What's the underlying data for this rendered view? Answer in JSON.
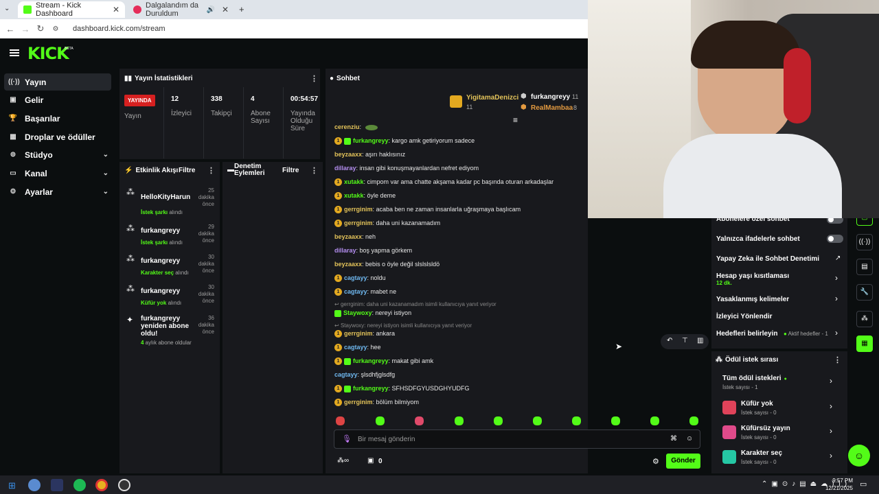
{
  "browser": {
    "tabs": [
      {
        "title": "Stream - Kick Dashboard"
      },
      {
        "title": "Dalgalandım da Duruldum"
      }
    ],
    "url": "dashboard.kick.com/stream"
  },
  "brand": {
    "logo": "KICK",
    "beta": "BETA",
    "accent": "#53fc18"
  },
  "sidebar": {
    "items": [
      {
        "label": "Yayın",
        "icon": "broadcast-icon"
      },
      {
        "label": "Gelir",
        "icon": "money-icon"
      },
      {
        "label": "Başarılar",
        "icon": "trophy-icon"
      },
      {
        "label": "Droplar ve ödüller",
        "icon": "gift-icon"
      },
      {
        "label": "Stüdyo",
        "icon": "studio-icon"
      },
      {
        "label": "Kanal",
        "icon": "channel-icon"
      },
      {
        "label": "Ayarlar",
        "icon": "gear-icon"
      }
    ]
  },
  "stats": {
    "title": "Yayın İstatistikleri",
    "live_badge": "YAYINDA",
    "cells": [
      {
        "value": "",
        "label": "Yayın"
      },
      {
        "value": "12",
        "label": "İzleyici"
      },
      {
        "value": "338",
        "label": "Takipçi"
      },
      {
        "value": "4",
        "label": "Abone Sayısı"
      },
      {
        "value": "00:54:57",
        "label": "Yayında Olduğu Süre"
      }
    ]
  },
  "activity": {
    "title": "Etkinlik Akışı",
    "filter": "Filtre",
    "items": [
      {
        "user": "HelloKityHarun",
        "time": "25 dakika önce",
        "highlight": "İstek şarkı",
        "rest": " alındı"
      },
      {
        "user": "furkangreyy",
        "time": "29 dakika önce",
        "highlight": "İstek şarkı",
        "rest": " alındı"
      },
      {
        "user": "furkangreyy",
        "time": "30 dakika önce",
        "highlight": "Karakter seç",
        "rest": " alındı"
      },
      {
        "user": "furkangreyy",
        "time": "30 dakika önce",
        "highlight": "Küfür yok",
        "rest": " alındı"
      },
      {
        "user": "furkangreyy yeniden abone oldu!",
        "time": "36 dakika önce",
        "highlight": "4",
        "rest": " aylık abone oldular"
      }
    ]
  },
  "moderation": {
    "title": "Denetim Eylemleri",
    "filter": "Filtre"
  },
  "chat": {
    "title": "Sohbet",
    "top_users": [
      {
        "name": "YigitamaDenizci",
        "count": "11"
      },
      {
        "name": "furkangreyy",
        "count": "11"
      },
      {
        "name": "RealMambaa",
        "count": "8"
      }
    ],
    "messages": [
      {
        "user": "cerenziu",
        "text": "",
        "color": "#e3c35a",
        "badges": 0
      },
      {
        "user": "furkangreyy",
        "text": "kargo amk getiriyorum sadece",
        "color": "#53fc18",
        "badges": 2
      },
      {
        "user": "beyzaaxx",
        "text": "aşırı haklısınız",
        "color": "#e3c35a",
        "badges": 0
      },
      {
        "user": "dillaray",
        "text": "insan gibi konuşmayanlardan nefret ediyom",
        "color": "#b48ef0",
        "badges": 0
      },
      {
        "user": "xutakk",
        "text": "cimpom var ama chatte akşama kadar pc başında oturan arkadaşlar",
        "color": "#53fc18",
        "badges": 1
      },
      {
        "user": "xutakk",
        "text": "öyle deme",
        "color": "#53fc18",
        "badges": 1
      },
      {
        "user": "gerrginim",
        "text": "acaba ben ne zaman insanlarla uğraşmaya başlıcam",
        "color": "#e3c35a",
        "badges": 1
      },
      {
        "user": "gerrginim",
        "text": "daha uni kazanamadım",
        "color": "#e3c35a",
        "badges": 1
      },
      {
        "user": "beyzaaxx",
        "text": "neh",
        "color": "#e3c35a",
        "badges": 0
      },
      {
        "user": "dillaray",
        "text": "boş yapma görkem",
        "color": "#b48ef0",
        "badges": 0
      },
      {
        "user": "beyzaaxx",
        "text": "bebis o öyle değil slslslsldö",
        "color": "#e3c35a",
        "badges": 0
      },
      {
        "user": "cagtayy",
        "text": "noldu",
        "color": "#6fb8f0",
        "badges": 1
      },
      {
        "user": "cagtayy",
        "text": "mabet ne",
        "color": "#6fb8f0",
        "badges": 1
      }
    ],
    "reply1": "gerrginim: daha uni kazanamadım isimli kullanıcıya yanıt veriyor",
    "msg_reply1": {
      "user": "Staywoxy",
      "text": "nereyi istiyon",
      "color": "#53fc18"
    },
    "reply2": "Staywoxy: nereyi istiyon isimli kullanıcıya yanıt veriyor",
    "messages2": [
      {
        "user": "gerrginim",
        "text": "ankara",
        "color": "#e3c35a",
        "badges": 1
      },
      {
        "user": "cagtayy",
        "text": "hee",
        "color": "#6fb8f0",
        "badges": 1
      },
      {
        "user": "furkangreyy",
        "text": "makat gibi amk",
        "color": "#53fc18",
        "badges": 2
      },
      {
        "user": "cagtayy",
        "text": "şlsdhfjglsdfg",
        "color": "#6fb8f0",
        "badges": 0
      },
      {
        "user": "furkangreyy",
        "text": "SFHSDFGYUSDGHYUDFG",
        "color": "#53fc18",
        "badges": 2
      },
      {
        "user": "gerrginim",
        "text": "bölüm bilmiyom",
        "color": "#e3c35a",
        "badges": 1
      }
    ],
    "input_placeholder": "Bir mesaj gönderin",
    "send_label": "Gönder",
    "points": "0"
  },
  "settings": {
    "items": [
      {
        "label": "Abonelere özel sohbet",
        "type": "toggle"
      },
      {
        "label": "Yalnızca ifadelerle sohbet",
        "type": "toggle"
      },
      {
        "label": "Yapay Zeka ile Sohbet Denetimi",
        "type": "link"
      },
      {
        "label": "Hesap yaşı kısıtlaması",
        "sub": "12 dk.",
        "type": "chevron"
      },
      {
        "label": "Yasaklanmış kelimeler",
        "type": "chevron"
      },
      {
        "label": "İzleyici Yönlendir",
        "type": "none"
      },
      {
        "label": "Hedefleri belirleyin",
        "extra": "Aktif hedefler - 1",
        "type": "chevron"
      }
    ]
  },
  "rewards": {
    "title": "Ödül istek sırası",
    "all_label": "Tüm ödül istekleri",
    "all_sub": "İstek sayısı - 1",
    "items": [
      {
        "title": "Küfür yok",
        "sub": "İstek sayısı - 0",
        "color": "#e0435a"
      },
      {
        "title": "Küfürsüz yayın",
        "sub": "İstek sayısı - 0",
        "color": "#e04a8a"
      },
      {
        "title": "Karakter seç",
        "sub": "İstek sayısı - 0",
        "color": "#25c7a4"
      }
    ]
  },
  "taskbar": {
    "time": "9:57 PM",
    "date": "12/21/2025"
  }
}
